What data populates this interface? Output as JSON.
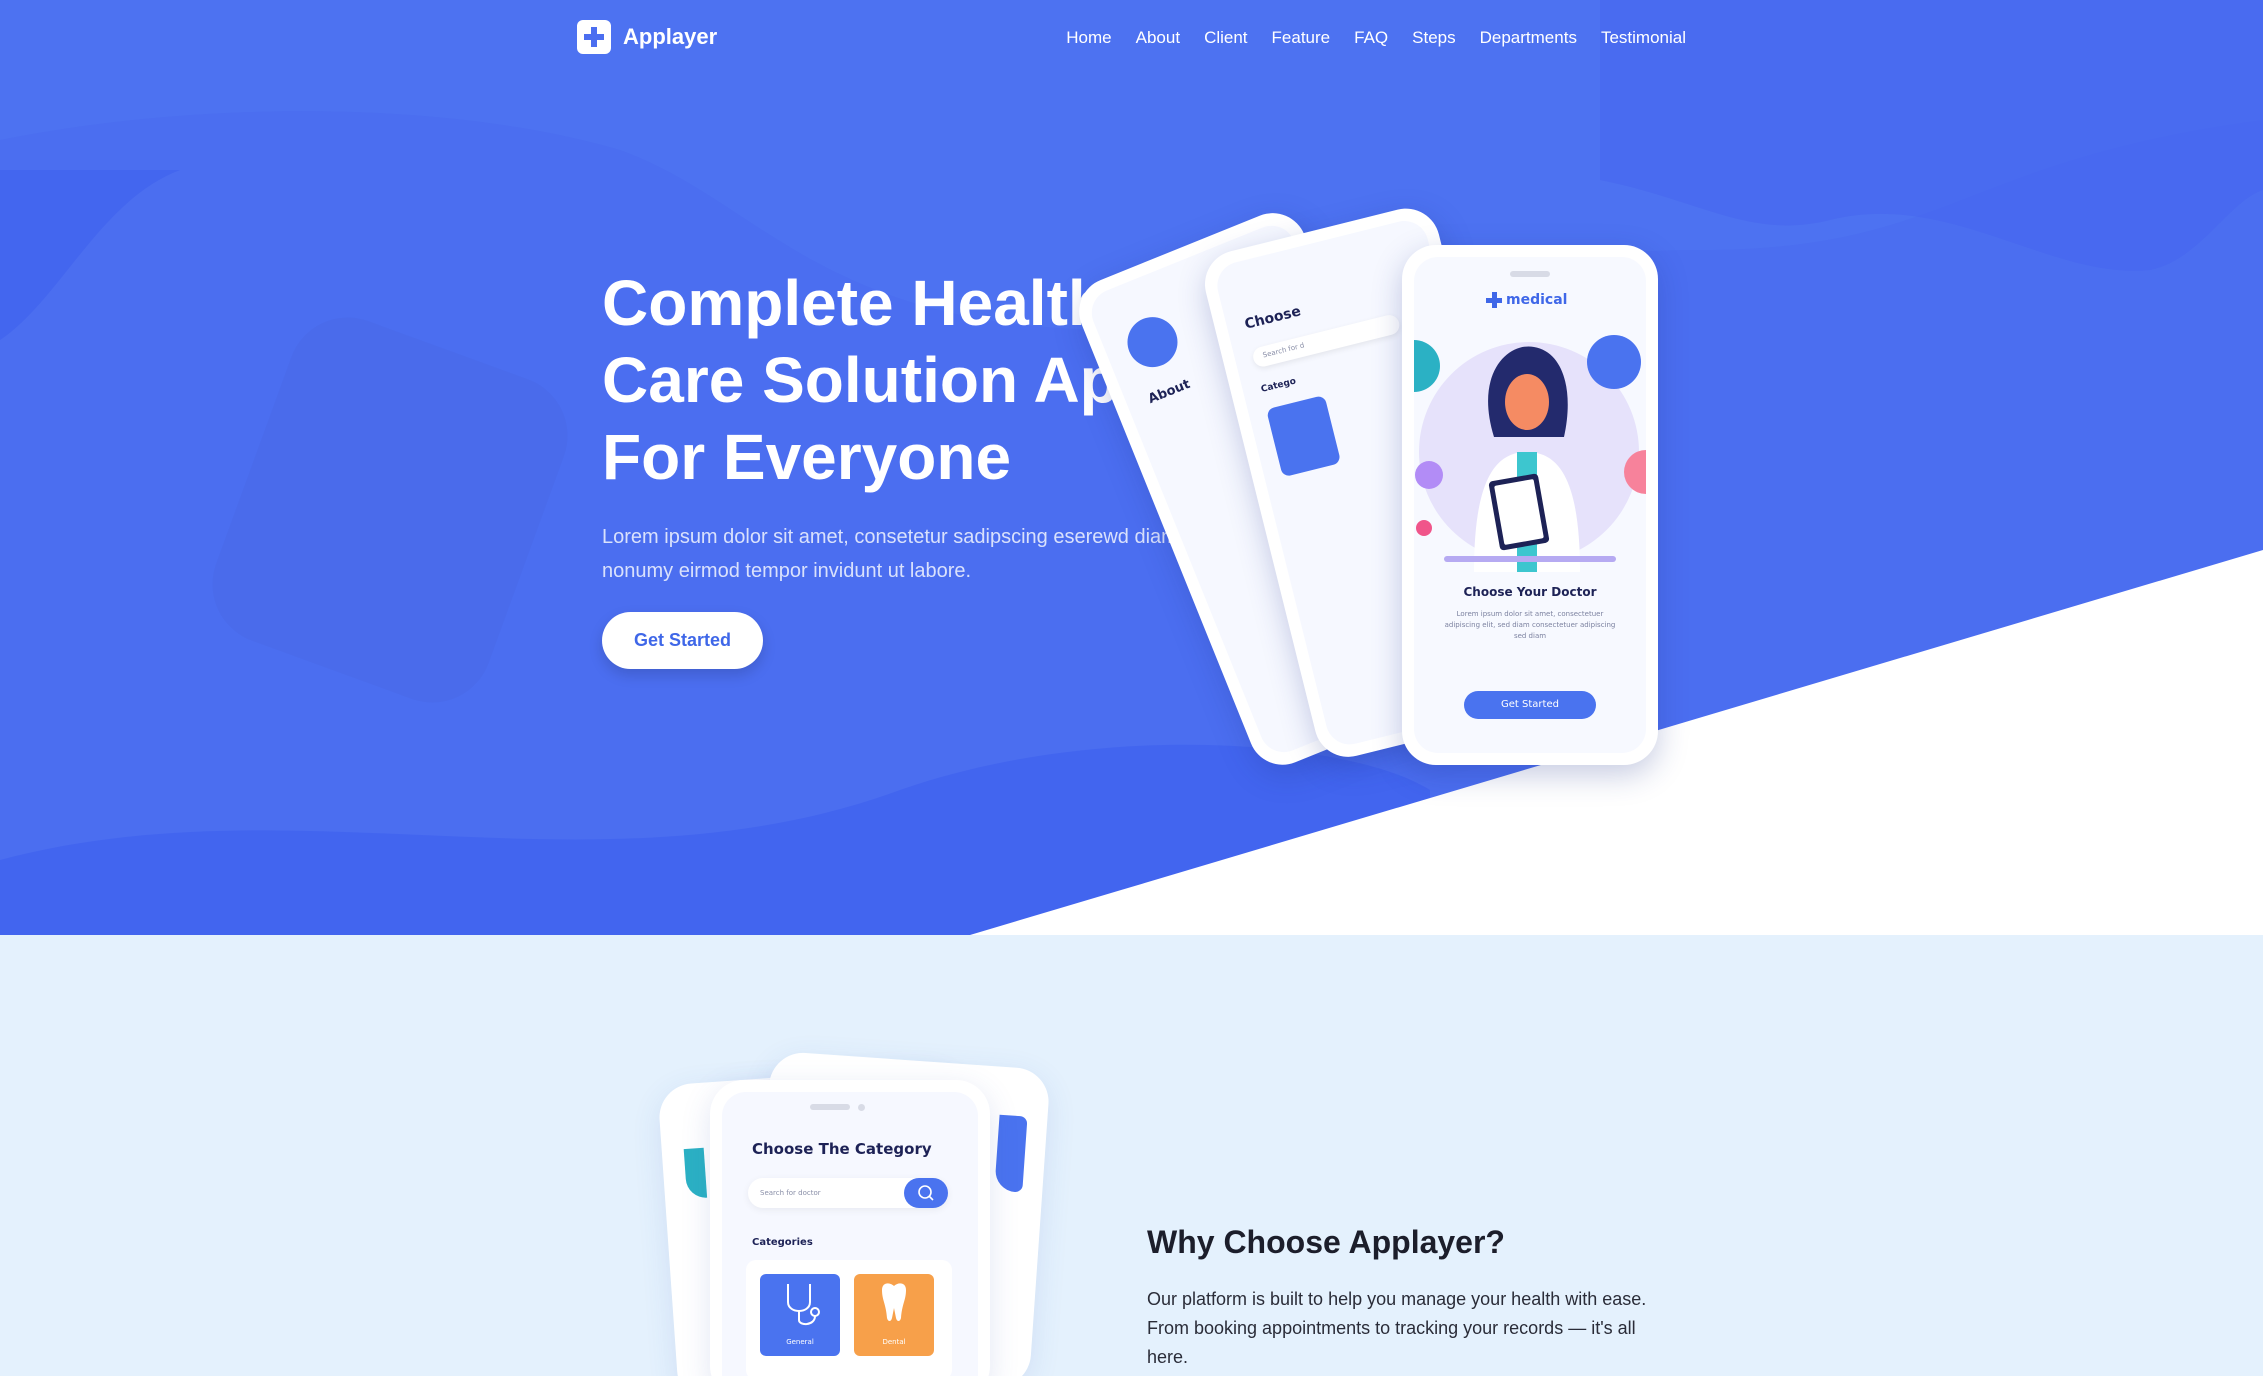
{
  "brand": {
    "name": "Applayer"
  },
  "nav": {
    "items": [
      "Home",
      "About",
      "Client",
      "Feature",
      "FAQ",
      "Steps",
      "Departments",
      "Testimonial"
    ]
  },
  "hero": {
    "title": "Complete Health-Care Solution App For Everyone",
    "description": "Lorem ipsum dolor sit amet, consetetur sadipscing eserewd diam nonumy eirmod tempor invidunt ut labore.",
    "button_label": "Get Started"
  },
  "hero_phone": {
    "brand": "medical",
    "heading": "Choose Your Doctor",
    "text": "Lorem ipsum dolor sit amet, consectetuer adipiscing elit, sed diam consectetuer adipiscing sed diam",
    "button_label": "Get Started",
    "back_phone_1_heading": "About",
    "back_phone_2_heading": "Choose",
    "back_phone_2_search": "Search for d",
    "back_phone_2_categories": "Catego"
  },
  "section2": {
    "title": "Why Choose Applayer?",
    "description": "Our platform is built to help you manage your health with ease. From booking appointments to tracking your records — it's all here."
  },
  "category_phone": {
    "heading": "Choose The Category",
    "search_placeholder": "Search for doctor",
    "categories_label": "Categories",
    "cards": [
      {
        "label": "General",
        "color": "#4a73ef"
      },
      {
        "label": "Dental",
        "color": "#f7a04a"
      }
    ]
  },
  "colors": {
    "primary": "#4b6ef0",
    "section_bg": "#e4f1fd",
    "button_text": "#3f67e8"
  }
}
